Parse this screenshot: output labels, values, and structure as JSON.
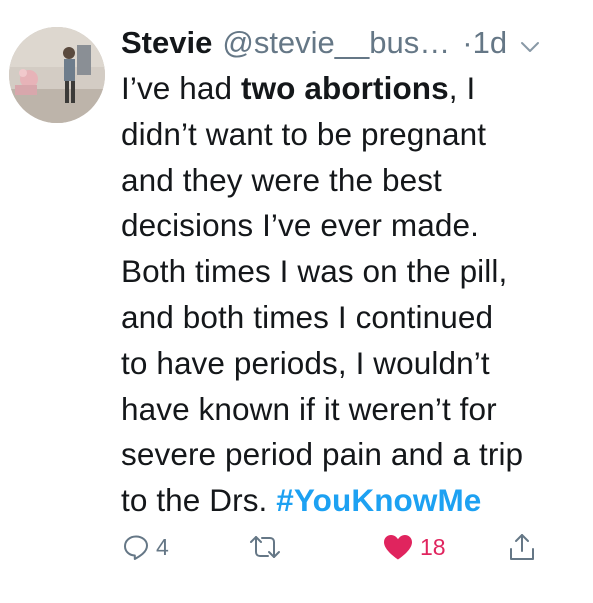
{
  "tweet": {
    "display_name": "Stevie",
    "handle": "@stevie__bus…",
    "separator": "·",
    "time": "1d",
    "text_lines": [
      {
        "parts": [
          "I’ve had ",
          "two abortions",
          ", I"
        ]
      },
      {
        "parts": [
          "didn’t want to be pregnant"
        ]
      },
      {
        "parts": [
          "and they were the best"
        ]
      },
      {
        "parts": [
          "decisions I’ve ever made."
        ]
      },
      {
        "parts": [
          "Both times I was on the pill,"
        ]
      },
      {
        "parts": [
          "and both times I continued"
        ]
      },
      {
        "parts": [
          "to have periods, I wouldn’t"
        ]
      },
      {
        "parts": [
          "have known if it weren’t for"
        ]
      },
      {
        "parts": [
          "severe period pain and a trip"
        ]
      },
      {
        "parts": [
          "to the Drs. ",
          "#YouKnowMe"
        ]
      }
    ],
    "actions": {
      "reply_count": "4",
      "retweet_count": "",
      "like_count": "18",
      "liked": true
    },
    "icons": {
      "reply": "reply-icon",
      "retweet": "retweet-icon",
      "like": "heart-icon",
      "share": "share-icon",
      "more": "chevron-down-icon"
    },
    "colors": {
      "text": "#14171a",
      "secondary": "#657786",
      "link": "#1da1f2",
      "like": "#e0245e"
    }
  }
}
